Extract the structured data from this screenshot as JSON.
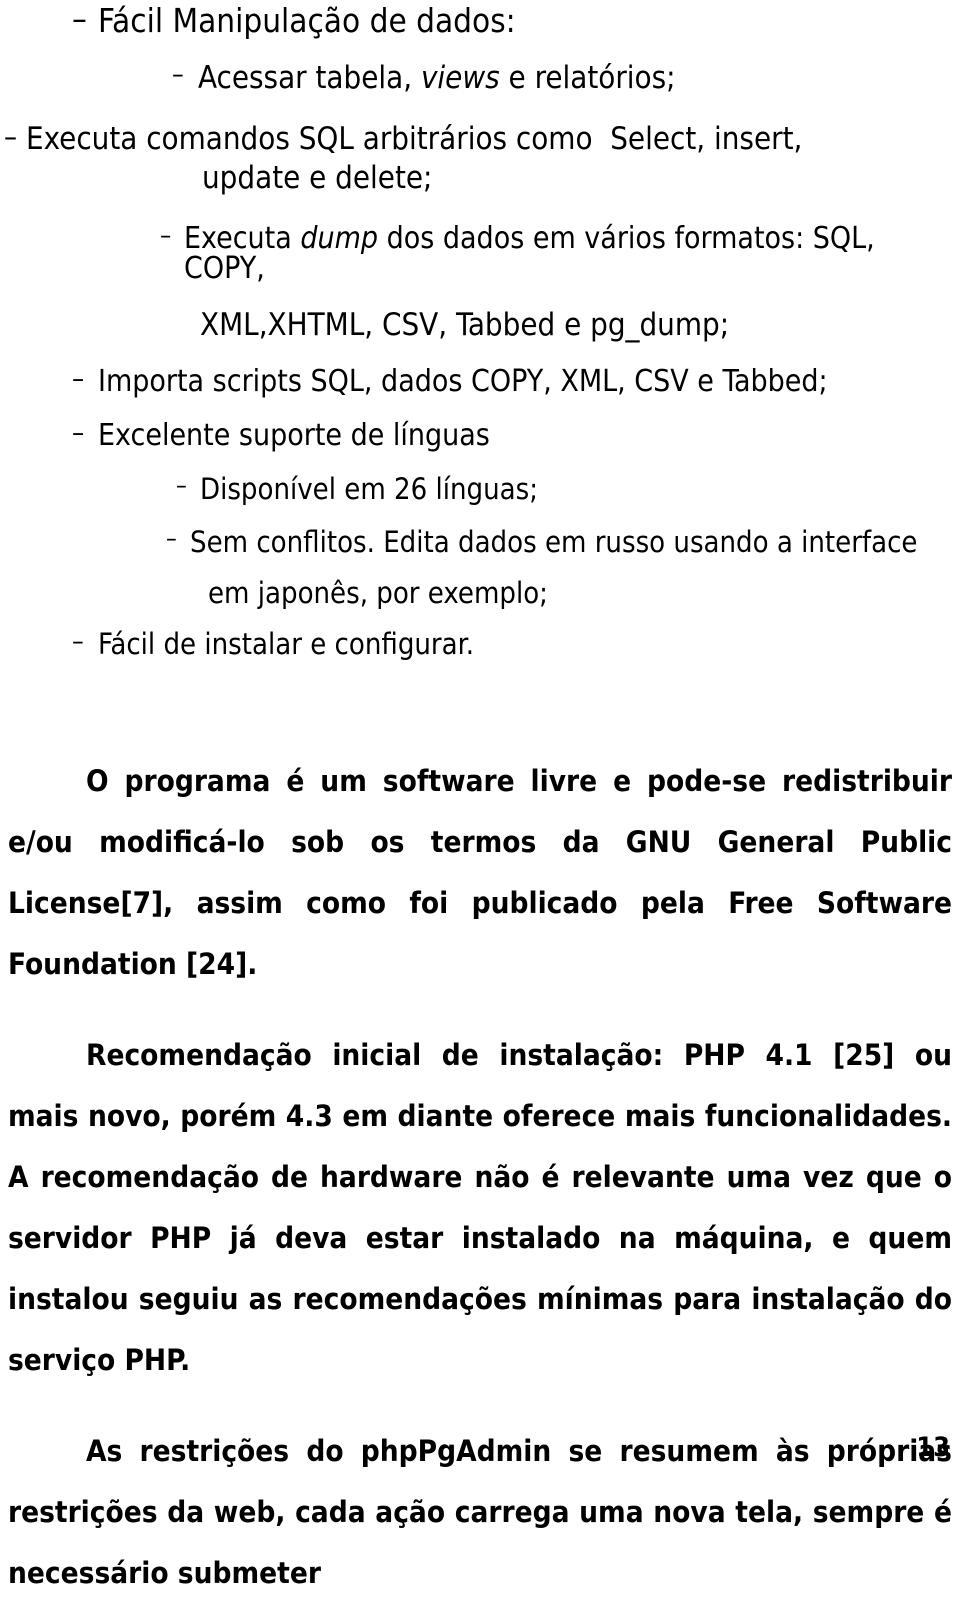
{
  "document": {
    "page_number": "13",
    "bullets": [
      {
        "marker": "–",
        "level": 1,
        "text": "Fácil Manipulação de dados:"
      },
      {
        "marker": "–",
        "level": 2,
        "text_before": "Acessar tabela, ",
        "emphasis": "views",
        "text_after": " e relatórios;"
      },
      {
        "marker": "–",
        "level": 0,
        "text": "Executa comandos SQL arbitrários como  Select, insert,"
      },
      {
        "marker": "",
        "level": "continuation",
        "text": "update e delete;"
      },
      {
        "marker": "–",
        "level": 2,
        "text_before": "Executa ",
        "emphasis": "dump",
        "text_after": " dos dados em vários formatos: SQL, COPY,"
      },
      {
        "marker": "",
        "level": "continuation",
        "text": "XML,XHTML, CSV, Tabbed e pg_dump;"
      },
      {
        "marker": "–",
        "level": 2,
        "text": "Importa scripts SQL, dados COPY, XML, CSV e Tabbed;"
      },
      {
        "marker": "–",
        "level": 1,
        "text": "Excelente suporte de línguas"
      },
      {
        "marker": "–",
        "level": 3,
        "text": "Disponível em 26 línguas;"
      },
      {
        "marker": "–",
        "level": 3,
        "text": "Sem conflitos. Edita dados em russo usando a interface"
      },
      {
        "marker": "",
        "level": "continuation",
        "text": "em japonês, por exemplo;"
      },
      {
        "marker": "–",
        "level": 1,
        "text": "Fácil de instalar e configurar."
      }
    ],
    "paragraphs": [
      "O programa é um software livre e pode-se redistribuir e/ou modificá-lo sob os termos da GNU General Public License[7], assim como foi publicado pela Free Software Foundation [24].",
      "Recomendação inicial de instalação: PHP 4.1 [25] ou mais novo, porém 4.3 em diante oferece mais funcionalidades. A recomendação de hardware não é relevante uma vez que o servidor PHP já deva estar instalado na máquina, e quem instalou seguiu as recomendações mínimas para instalação do serviço PHP.",
      "As restrições do phpPgAdmin se resumem às próprias restrições da web, cada ação carrega uma nova tela, sempre é necessário submeter"
    ]
  }
}
